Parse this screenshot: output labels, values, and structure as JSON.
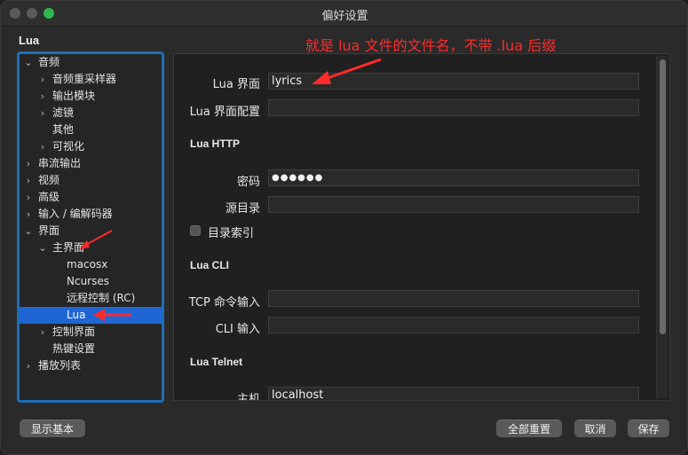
{
  "window": {
    "title": "偏好设置"
  },
  "section_title": "Lua",
  "annotation": "就是 lua 文件的文件名，不带 .lua 后缀",
  "tree": {
    "items": [
      {
        "label": "音频",
        "expandable": true,
        "expanded": true,
        "level": 0
      },
      {
        "label": "音频重采样器",
        "expandable": true,
        "expanded": false,
        "level": 1
      },
      {
        "label": "输出模块",
        "expandable": true,
        "expanded": false,
        "level": 1
      },
      {
        "label": "滤镜",
        "expandable": true,
        "expanded": false,
        "level": 1
      },
      {
        "label": "其他",
        "expandable": false,
        "expanded": false,
        "level": 1
      },
      {
        "label": "可视化",
        "expandable": true,
        "expanded": false,
        "level": 1
      },
      {
        "label": "串流输出",
        "expandable": true,
        "expanded": false,
        "level": 0
      },
      {
        "label": "视频",
        "expandable": true,
        "expanded": false,
        "level": 0
      },
      {
        "label": "高级",
        "expandable": true,
        "expanded": false,
        "level": 0
      },
      {
        "label": "输入 / 编解码器",
        "expandable": true,
        "expanded": false,
        "level": 0
      },
      {
        "label": "界面",
        "expandable": true,
        "expanded": true,
        "level": 0
      },
      {
        "label": "主界面",
        "expandable": true,
        "expanded": true,
        "level": 1
      },
      {
        "label": "macosx",
        "expandable": false,
        "expanded": false,
        "level": 2
      },
      {
        "label": "Ncurses",
        "expandable": false,
        "expanded": false,
        "level": 2
      },
      {
        "label": "远程控制 (RC)",
        "expandable": false,
        "expanded": false,
        "level": 2
      },
      {
        "label": "Lua",
        "expandable": false,
        "expanded": false,
        "level": 2,
        "selected": true
      },
      {
        "label": "控制界面",
        "expandable": true,
        "expanded": false,
        "level": 1
      },
      {
        "label": "热键设置",
        "expandable": false,
        "expanded": false,
        "level": 1
      },
      {
        "label": "播放列表",
        "expandable": true,
        "expanded": false,
        "level": 0
      }
    ]
  },
  "form": {
    "lua_intf_label": "Lua 界面",
    "lua_intf_value": "lyrics",
    "lua_config_label": "Lua 界面配置",
    "lua_config_value": "",
    "http_group": "Lua HTTP",
    "password_label": "密码",
    "password_value": "●●●●●●",
    "src_dir_label": "源目录",
    "src_dir_value": "",
    "dir_index_label": "目录索引",
    "dir_index_checked": false,
    "cli_group": "Lua CLI",
    "tcp_label": "TCP 命令输入",
    "tcp_value": "",
    "cli_input_label": "CLI 输入",
    "cli_input_value": "",
    "telnet_group": "Lua Telnet",
    "host_label": "主机",
    "host_value": "localhost"
  },
  "buttons": {
    "show_basic": "显示基本",
    "reset_all": "全部重置",
    "cancel": "取消",
    "save": "保存"
  },
  "colors": {
    "accent": "#1f66d4",
    "annotation": "#ff2b2b",
    "panel_border": "#1e6fb8"
  }
}
